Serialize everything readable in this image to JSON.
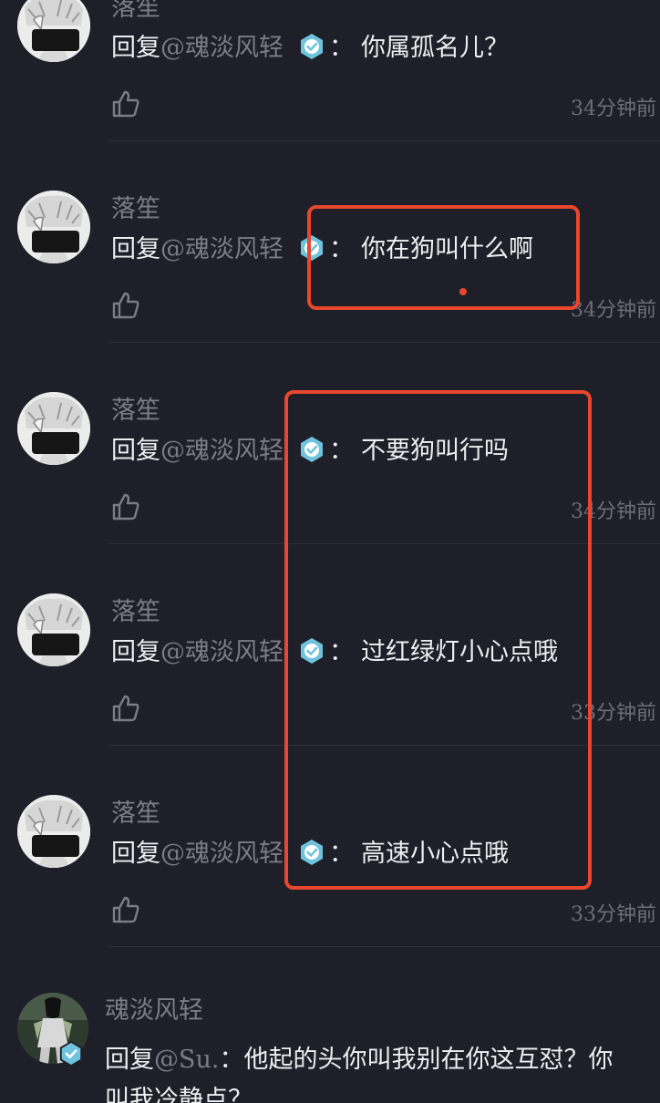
{
  "comments": [
    {
      "username": "落笙",
      "reply_prefix": "回复",
      "mention": "@魂淡风轻",
      "colon": "：",
      "body": "你属孤名儿？",
      "time": "34分钟前"
    },
    {
      "username": "落笙",
      "reply_prefix": "回复",
      "mention": "@魂淡风轻",
      "colon": "：",
      "body": "你在狗叫什么啊",
      "time": "34分钟前"
    },
    {
      "username": "落笙",
      "reply_prefix": "回复",
      "mention": "@魂淡风轻",
      "colon": "：",
      "body": "不要狗叫行吗",
      "time": "34分钟前"
    },
    {
      "username": "落笙",
      "reply_prefix": "回复",
      "mention": "@魂淡风轻",
      "colon": "：",
      "body": "过红绿灯小心点哦",
      "time": "33分钟前"
    },
    {
      "username": "落笙",
      "reply_prefix": "回复",
      "mention": "@魂淡风轻",
      "colon": "：",
      "body": "高速小心点哦",
      "time": "33分钟前"
    }
  ],
  "last_comment": {
    "username": "魂淡风轻",
    "line1_prefix": "回复",
    "line1_mention": "@Su.",
    "line1_rest": "：他起的头你叫我别在你这互怼？你",
    "line2": "叫我冷静点？"
  },
  "colors": {
    "background": "#1f1f29",
    "primary_text": "#ededf2",
    "secondary_text": "#7c7c86",
    "verified_badge": "#6fc3dc",
    "annotation": "#e8472e"
  },
  "icons": {
    "like": "thumbs-up-icon",
    "verified": "verified-check-icon"
  }
}
